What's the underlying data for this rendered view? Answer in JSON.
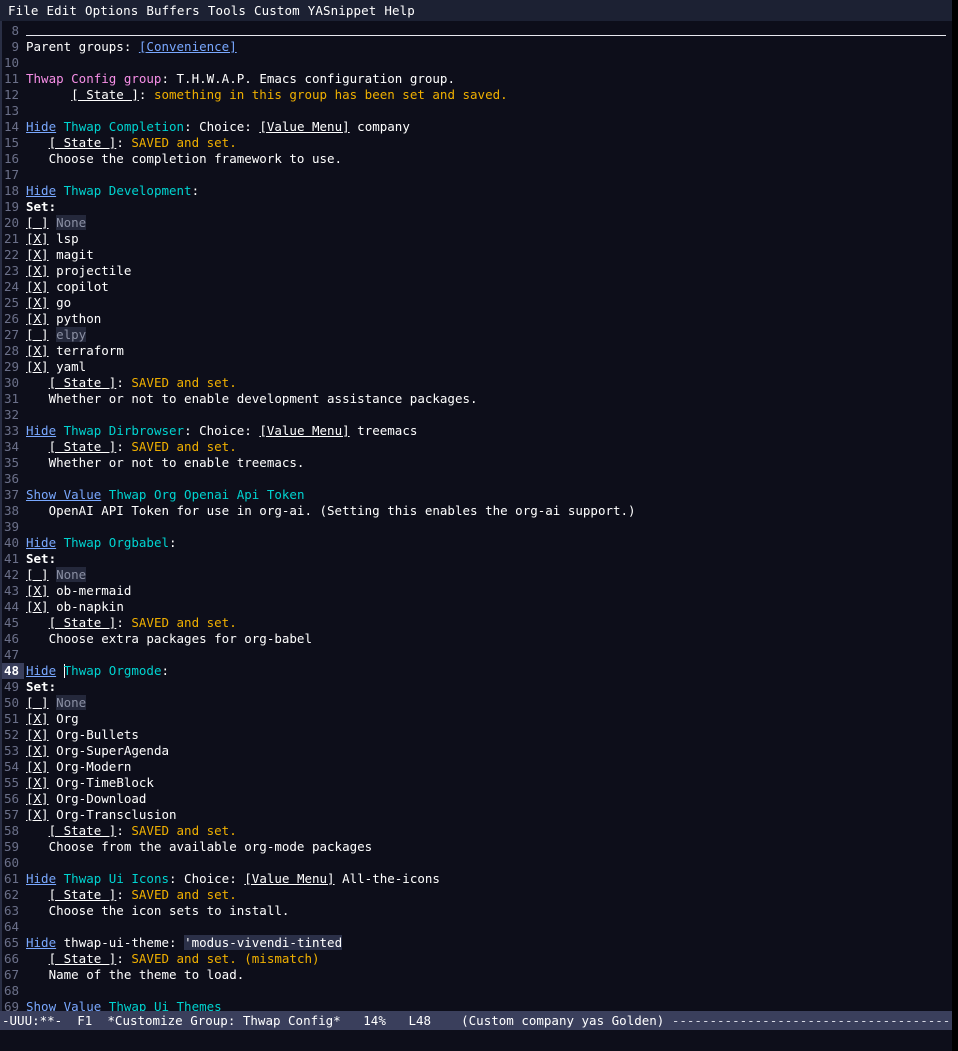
{
  "menubar": {
    "items": [
      "File",
      "Edit",
      "Options",
      "Buffers",
      "Tools",
      "Custom",
      "YASnippet",
      "Help"
    ]
  },
  "colors": {
    "background": "#0d0e1a",
    "menubar_bg": "#1c2133",
    "modeline_bg": "#3a3f5c",
    "link": "#79a8ff",
    "group_name": "#00d3d0",
    "magenta": "#f78fe7",
    "state_value": "#f0b000",
    "linenum": "#6b7089",
    "inactive_value": "#8a8fa3"
  },
  "buffer": {
    "lines": [
      {
        "num": "8",
        "kind": "rule"
      },
      {
        "num": "9",
        "kind": "parent",
        "label": "Parent groups: ",
        "link": "[Convenience]"
      },
      {
        "num": "10",
        "kind": "blank"
      },
      {
        "num": "11",
        "kind": "grouphead_magenta",
        "name": "Thwap Config group",
        "sep": ": ",
        "doc": "T.H.W.A.P. Emacs configuration group."
      },
      {
        "num": "12",
        "kind": "state",
        "indent": "      ",
        "button": "[ State ]",
        "sep": ": ",
        "value": "something in this group has been set and saved."
      },
      {
        "num": "13",
        "kind": "blank"
      },
      {
        "num": "14",
        "kind": "choice",
        "toggle": "Hide",
        "name": "Thwap Completion",
        "sep": ": Choice: ",
        "menu": "[Value Menu]",
        "value": " company"
      },
      {
        "num": "15",
        "kind": "state",
        "indent": "   ",
        "button": "[ State ]",
        "sep": ": ",
        "value": "SAVED and set."
      },
      {
        "num": "16",
        "kind": "doc",
        "indent": "   ",
        "text": "Choose the completion framework to use."
      },
      {
        "num": "17",
        "kind": "blank"
      },
      {
        "num": "18",
        "kind": "grouphead",
        "toggle": "Hide",
        "name": "Thwap Development",
        "sep": ":"
      },
      {
        "num": "19",
        "kind": "set",
        "text": "Set:"
      },
      {
        "num": "20",
        "kind": "checkbox",
        "box": "[ ]",
        "label": "None",
        "checked": false
      },
      {
        "num": "21",
        "kind": "checkbox",
        "box": "[X]",
        "label": "lsp",
        "checked": true
      },
      {
        "num": "22",
        "kind": "checkbox",
        "box": "[X]",
        "label": "magit",
        "checked": true
      },
      {
        "num": "23",
        "kind": "checkbox",
        "box": "[X]",
        "label": "projectile",
        "checked": true
      },
      {
        "num": "24",
        "kind": "checkbox",
        "box": "[X]",
        "label": "copilot",
        "checked": true
      },
      {
        "num": "25",
        "kind": "checkbox",
        "box": "[X]",
        "label": "go",
        "checked": true
      },
      {
        "num": "26",
        "kind": "checkbox",
        "box": "[X]",
        "label": "python",
        "checked": true
      },
      {
        "num": "27",
        "kind": "checkbox",
        "box": "[ ]",
        "label": "elpy",
        "checked": false
      },
      {
        "num": "28",
        "kind": "checkbox",
        "box": "[X]",
        "label": "terraform",
        "checked": true
      },
      {
        "num": "29",
        "kind": "checkbox",
        "box": "[X]",
        "label": "yaml",
        "checked": true
      },
      {
        "num": "30",
        "kind": "state",
        "indent": "   ",
        "button": "[ State ]",
        "sep": ": ",
        "value": "SAVED and set."
      },
      {
        "num": "31",
        "kind": "doc",
        "indent": "   ",
        "text": "Whether or not to enable development assistance packages."
      },
      {
        "num": "32",
        "kind": "blank"
      },
      {
        "num": "33",
        "kind": "choice",
        "toggle": "Hide",
        "name": "Thwap Dirbrowser",
        "sep": ": Choice: ",
        "menu": "[Value Menu]",
        "value": " treemacs"
      },
      {
        "num": "34",
        "kind": "state",
        "indent": "   ",
        "button": "[ State ]",
        "sep": ": ",
        "value": "SAVED and set."
      },
      {
        "num": "35",
        "kind": "doc",
        "indent": "   ",
        "text": "Whether or not to enable treemacs."
      },
      {
        "num": "36",
        "kind": "blank"
      },
      {
        "num": "37",
        "kind": "grouphead",
        "toggle": "Show Value",
        "name": "Thwap Org Openai Api Token",
        "sep": ""
      },
      {
        "num": "38",
        "kind": "doc",
        "indent": "   ",
        "text": "OpenAI API Token for use in org-ai. (Setting this enables the org-ai support.)"
      },
      {
        "num": "39",
        "kind": "blank"
      },
      {
        "num": "40",
        "kind": "grouphead",
        "toggle": "Hide",
        "name": "Thwap Orgbabel",
        "sep": ":"
      },
      {
        "num": "41",
        "kind": "set",
        "text": "Set:"
      },
      {
        "num": "42",
        "kind": "checkbox",
        "box": "[ ]",
        "label": "None",
        "checked": false
      },
      {
        "num": "43",
        "kind": "checkbox",
        "box": "[X]",
        "label": "ob-mermaid",
        "checked": true
      },
      {
        "num": "44",
        "kind": "checkbox",
        "box": "[X]",
        "label": "ob-napkin",
        "checked": true
      },
      {
        "num": "45",
        "kind": "state",
        "indent": "   ",
        "button": "[ State ]",
        "sep": ": ",
        "value": "SAVED and set."
      },
      {
        "num": "46",
        "kind": "doc",
        "indent": "   ",
        "text": "Choose extra packages for org-babel"
      },
      {
        "num": "47",
        "kind": "blank"
      },
      {
        "num": "48",
        "kind": "grouphead",
        "toggle": "Hide",
        "name": "Thwap Orgmode",
        "sep": ":",
        "current": true,
        "cursor": true
      },
      {
        "num": "49",
        "kind": "set",
        "text": "Set:"
      },
      {
        "num": "50",
        "kind": "checkbox",
        "box": "[ ]",
        "label": "None",
        "checked": false
      },
      {
        "num": "51",
        "kind": "checkbox",
        "box": "[X]",
        "label": "Org",
        "checked": true
      },
      {
        "num": "52",
        "kind": "checkbox",
        "box": "[X]",
        "label": "Org-Bullets",
        "checked": true
      },
      {
        "num": "53",
        "kind": "checkbox",
        "box": "[X]",
        "label": "Org-SuperAgenda",
        "checked": true
      },
      {
        "num": "54",
        "kind": "checkbox",
        "box": "[X]",
        "label": "Org-Modern",
        "checked": true
      },
      {
        "num": "55",
        "kind": "checkbox",
        "box": "[X]",
        "label": "Org-TimeBlock",
        "checked": true
      },
      {
        "num": "56",
        "kind": "checkbox",
        "box": "[X]",
        "label": "Org-Download",
        "checked": true
      },
      {
        "num": "57",
        "kind": "checkbox",
        "box": "[X]",
        "label": "Org-Transclusion",
        "checked": true
      },
      {
        "num": "58",
        "kind": "state",
        "indent": "   ",
        "button": "[ State ]",
        "sep": ": ",
        "value": "SAVED and set."
      },
      {
        "num": "59",
        "kind": "doc",
        "indent": "   ",
        "text": "Choose from the available org-mode packages"
      },
      {
        "num": "60",
        "kind": "blank"
      },
      {
        "num": "61",
        "kind": "choice",
        "toggle": "Hide",
        "name": "Thwap Ui Icons",
        "sep": ": Choice: ",
        "menu": "[Value Menu]",
        "value": " All-the-icons"
      },
      {
        "num": "62",
        "kind": "state",
        "indent": "   ",
        "button": "[ State ]",
        "sep": ": ",
        "value": "SAVED and set."
      },
      {
        "num": "63",
        "kind": "doc",
        "indent": "   ",
        "text": "Choose the icon sets to install."
      },
      {
        "num": "64",
        "kind": "blank"
      },
      {
        "num": "65",
        "kind": "variable",
        "toggle": "Hide",
        "name": "thwap-ui-theme",
        "sep": ": ",
        "value": "'modus-vivendi-tinted"
      },
      {
        "num": "66",
        "kind": "state_mismatch",
        "indent": "   ",
        "button": "[ State ]",
        "sep": ": ",
        "value": "SAVED and set.",
        "extra": " (mismatch)"
      },
      {
        "num": "67",
        "kind": "doc",
        "indent": "   ",
        "text": "Name of the theme to load."
      },
      {
        "num": "68",
        "kind": "blank"
      },
      {
        "num": "69",
        "kind": "grouphead",
        "toggle": "Show Value",
        "name": "Thwap Ui Themes",
        "sep": ""
      }
    ]
  },
  "modeline": {
    "status": "-UUU:**-",
    "frame": "F1",
    "buffer_name": "*Customize Group: Thwap Config*",
    "percent": "14%",
    "line_pos": "L48",
    "modes": "(Custom company yas Golden)",
    "fill": "---------------------------------------------------------------------------------"
  }
}
